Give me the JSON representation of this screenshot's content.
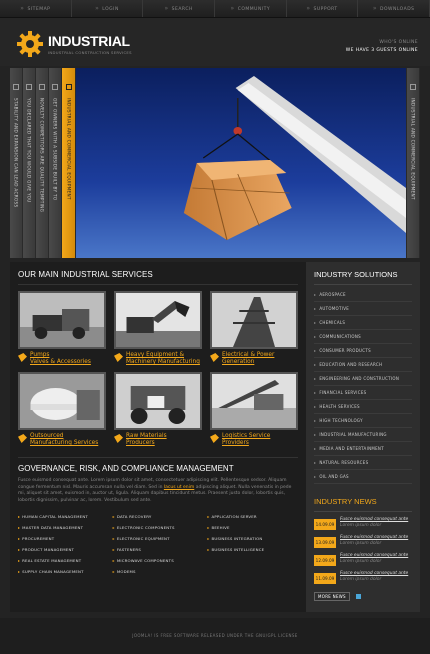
{
  "nav": [
    "SITEMAP",
    "LOGIN",
    "SEARCH",
    "COMMUNITY",
    "SUPPORT",
    "DOWNLOADS"
  ],
  "header": {
    "logo": "INDUSTRIAL",
    "tagline": "INDUSTRIAL CONSTRUCTION SERVICES",
    "whos_online": "WHO'S ONLINE",
    "guests": "WE HAVE 3 GUESTS ONLINE"
  },
  "hero": {
    "tabs": [
      "STABILITY AND EXPANSION CAN LEAD ACROSS",
      "YOU DECLARED THAT YOU WOULD GIVE YOU",
      "NOVELTY COMPETITORS ARE QUALITY TEMPTING",
      "GET OWNERS WITH A SUBSIDE BUILT BY TO",
      "INDUSTRIAL AND COMMERCIAL EQUIPMENT"
    ],
    "right_tab": "INDUSTRIAL AND COMMERCIAL EQUIPMENT"
  },
  "services": {
    "title": "OUR MAIN INDUSTRIAL SERVICES",
    "items": [
      {
        "line1": "Pumps",
        "line2": "Valves & Accessories"
      },
      {
        "line1": "Heavy Equipment &",
        "line2": "Machinery Manufacturing"
      },
      {
        "line1": "Electrical & Power",
        "line2": "Generation"
      },
      {
        "line1": "Outsourced",
        "line2": "Manufacturing Services"
      },
      {
        "line1": "Raw Materials",
        "line2": "Producers"
      },
      {
        "line1": "Logistics Service",
        "line2": "Providers"
      }
    ]
  },
  "governance": {
    "title": "GOVERNANCE, RISK, AND COMPLIANCE MANAGEMENT",
    "text_before": "Fusce euismod consequat ante. Lorem ipsum dolor sit amet, consectetuer adipiscing elit. Pellentesque sedsor. Aliquam congue fermentum nisl. Mauris accumsan nulla vel diam. Sed in ",
    "link": "lacus ut enim",
    "text_after": " adipiscing aliquet. Nulla venenatis in pede mi, aliquet sit amet, euismod in, auctor ut, ligula. Aliquam dapibus tincidunt metus. Praesent justo dolor, lobortis quis, lobortis dignissim, pulvinar ac, lorem. Vestibulum sed ante.",
    "col1": [
      "HUMAN CAPITAL MANAGEMENT",
      "MASTER DATA MANAGEMENT",
      "PROCUREMENT",
      "PRODUCT MANAGEMENT",
      "REAL ESTATE MANAGEMENT",
      "SUPPLY CHAIN MANAGEMENT"
    ],
    "col2": [
      "DATA RECOVERY",
      "ELECTRONIC COMPONENTS",
      "ELECTRONIC EQUIPMENT",
      "FASTENERS",
      "MICROWAVE COMPONENTS",
      "MODEMS"
    ],
    "col3": [
      "APPLICATION SERVER",
      "BEEHIVE",
      "BUSINESS INTEGRATION",
      "BUSINESS INTELLIGENCE"
    ]
  },
  "solutions": {
    "title": "INDUSTRY SOLUTIONS",
    "items": [
      "AEROSPACE",
      "AUTOMOTIVE",
      "CHEMICALS",
      "COMMUNICATIONS",
      "CONSUMER PRODUCTS",
      "EDUCATION AND RESEARCH",
      "ENGINEERING AND CONSTRUCTION",
      "FINANCIAL SERVICES",
      "HEALTH SERVICES",
      "HIGH TECHNOLOGY",
      "INDUSTRIAL MANUFACTURING",
      "MEDIA AND ENTERTAINMENT",
      "NATURAL RESOURCES",
      "OIL AND GAS"
    ]
  },
  "news": {
    "title": "INDUSTRY NEWS",
    "items": [
      {
        "date": "14.09.09",
        "t1": "Fusce euismod consequat ante",
        "t2": "Lorem ipsum dolor"
      },
      {
        "date": "13.09.09",
        "t1": "Fusce euismod consequat ante",
        "t2": "Lorem ipsum dolor"
      },
      {
        "date": "12.09.09",
        "t1": "Fusce euismod consequat ante",
        "t2": "Lorem ipsum dolor"
      },
      {
        "date": "11.09.09",
        "t1": "Fusce euismod consequat ante",
        "t2": "Lorem ipsum dolor"
      }
    ],
    "more": "MORE NEWS"
  },
  "footer": "JOOMLA! IS FREE SOFTWARE RELEASED UNDER THE GNU/GPL LICENSE",
  "colors": {
    "accent": "#f3a81a",
    "bg": "#232323"
  }
}
